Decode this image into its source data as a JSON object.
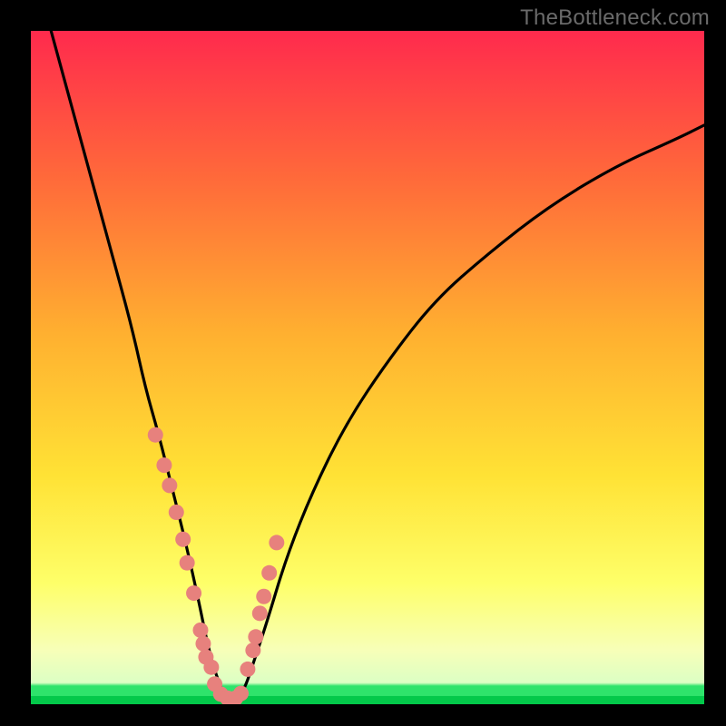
{
  "watermark": "TheBottleneck.com",
  "colors": {
    "black": "#000000",
    "curve": "#000000",
    "marker_fill": "#e7817d",
    "marker_stroke": "#b85c57",
    "green_band_top": "#2ee36b",
    "green_band_bottom": "#03c84a",
    "grad_top": "#ff2a4d",
    "grad_mid1": "#ff6a3a",
    "grad_mid2": "#ffb030",
    "grad_mid3": "#ffe235",
    "grad_low": "#feff69",
    "grad_lighter": "#f7ffb8"
  },
  "chart_data": {
    "type": "line",
    "title": "",
    "xlabel": "",
    "ylabel": "",
    "xlim": [
      0,
      100
    ],
    "ylim": [
      0,
      100
    ],
    "series": [
      {
        "name": "bottleneck-curve",
        "x": [
          3,
          6,
          9,
          12,
          15,
          17,
          19,
          21,
          23,
          25,
          26,
          27,
          28,
          29,
          30,
          31,
          32,
          33,
          35,
          38,
          42,
          47,
          53,
          60,
          68,
          77,
          87,
          96,
          100
        ],
        "values": [
          100,
          89,
          78,
          67,
          56,
          47,
          40,
          32,
          24,
          15,
          10,
          6,
          3,
          1,
          0.6,
          1,
          3,
          6,
          12,
          22,
          32,
          42,
          51,
          60,
          67,
          74,
          80,
          84,
          86
        ]
      }
    ],
    "markers": {
      "name": "highlighted-points",
      "x": [
        18.5,
        19.8,
        20.6,
        21.6,
        22.6,
        23.2,
        24.2,
        25.2,
        25.6,
        26.0,
        26.8,
        27.3,
        28.2,
        29.2,
        30.4,
        31.2,
        32.2,
        33.0,
        33.4,
        34.0,
        34.6,
        35.4,
        36.5
      ],
      "values": [
        40.0,
        35.5,
        32.5,
        28.5,
        24.5,
        21.0,
        16.5,
        11.0,
        9.0,
        7.0,
        5.5,
        3.0,
        1.5,
        0.9,
        0.9,
        1.6,
        5.2,
        8.0,
        10.0,
        13.5,
        16.0,
        19.5,
        24.0
      ]
    },
    "green_band": {
      "y0": 0,
      "y1": 2.7
    }
  }
}
